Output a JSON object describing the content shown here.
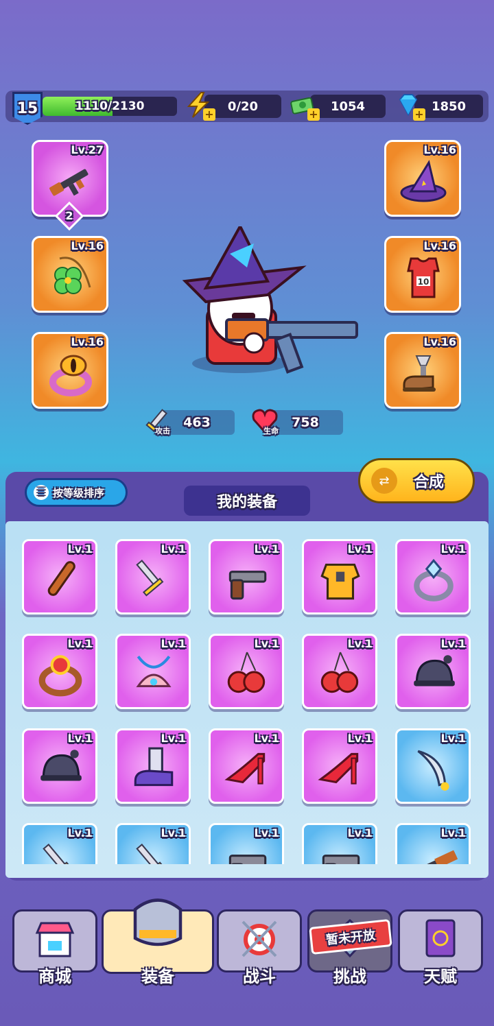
{
  "player": {
    "level": "15",
    "xp_text": "1110/2130",
    "xp_fraction": 0.52
  },
  "resources": [
    {
      "name": "energy",
      "icon": "lightning-icon",
      "value": "0/20"
    },
    {
      "name": "cash",
      "icon": "cash-icon",
      "value": "1054"
    },
    {
      "name": "gems",
      "icon": "diamond-icon",
      "value": "1850"
    }
  ],
  "equipped": [
    {
      "slot": "weapon",
      "icon": "rifle-icon",
      "level": "Lv.27",
      "rank": "2",
      "rarity": "pink"
    },
    {
      "slot": "hat",
      "icon": "wizard-hat-icon",
      "level": "Lv.16",
      "rarity": "orange"
    },
    {
      "slot": "necklace",
      "icon": "clover-necklace-icon",
      "level": "Lv.16",
      "rarity": "orange"
    },
    {
      "slot": "armor",
      "icon": "jersey-icon",
      "level": "Lv.16",
      "rarity": "orange"
    },
    {
      "slot": "ring",
      "icon": "eye-ring-icon",
      "level": "Lv.16",
      "rarity": "orange"
    },
    {
      "slot": "boots",
      "icon": "boots-icon",
      "level": "Lv.16",
      "rarity": "orange"
    }
  ],
  "stats": {
    "attack": {
      "label": "攻击",
      "value": "463"
    },
    "hp": {
      "label": "生命",
      "value": "758"
    }
  },
  "panel": {
    "sort_label": "按等级排序",
    "title": "我的装备",
    "combine_label": "合成"
  },
  "inventory": [
    {
      "icon": "bat-icon",
      "level": "Lv.1",
      "rarity": "pink"
    },
    {
      "icon": "dagger-icon",
      "level": "Lv.1",
      "rarity": "pink"
    },
    {
      "icon": "revolver-icon",
      "level": "Lv.1",
      "rarity": "pink"
    },
    {
      "icon": "chest-armor-icon",
      "level": "Lv.1",
      "rarity": "pink"
    },
    {
      "icon": "gem-ring-icon",
      "level": "Lv.1",
      "rarity": "pink"
    },
    {
      "icon": "ruby-ring-icon",
      "level": "Lv.1",
      "rarity": "pink"
    },
    {
      "icon": "shell-necklace-icon",
      "level": "Lv.1",
      "rarity": "pink"
    },
    {
      "icon": "boxing-gloves-icon",
      "level": "Lv.1",
      "rarity": "pink"
    },
    {
      "icon": "boxing-gloves-icon",
      "level": "Lv.1",
      "rarity": "pink"
    },
    {
      "icon": "helmet-icon",
      "level": "Lv.1",
      "rarity": "pink"
    },
    {
      "icon": "helmet-icon",
      "level": "Lv.1",
      "rarity": "pink"
    },
    {
      "icon": "sneaker-icon",
      "level": "Lv.1",
      "rarity": "pink"
    },
    {
      "icon": "high-heel-icon",
      "level": "Lv.1",
      "rarity": "pink"
    },
    {
      "icon": "high-heel-icon",
      "level": "Lv.1",
      "rarity": "pink"
    },
    {
      "icon": "curved-dagger-icon",
      "level": "Lv.1",
      "rarity": "blue"
    },
    {
      "icon": "dagger-icon",
      "level": "Lv.1",
      "rarity": "blue"
    },
    {
      "icon": "dagger-icon",
      "level": "Lv.1",
      "rarity": "blue"
    },
    {
      "icon": "revolver-icon",
      "level": "Lv.1",
      "rarity": "blue"
    },
    {
      "icon": "revolver-icon",
      "level": "Lv.1",
      "rarity": "blue"
    },
    {
      "icon": "rifle-icon",
      "level": "Lv.1",
      "rarity": "blue"
    }
  ],
  "nav": [
    {
      "icon": "shop-icon",
      "label": "商城",
      "state": "normal"
    },
    {
      "icon": "armor-icon",
      "label": "装备",
      "state": "active"
    },
    {
      "icon": "battle-target-icon",
      "label": "战斗",
      "state": "normal"
    },
    {
      "icon": "challenge-icon",
      "label": "挑战",
      "state": "locked",
      "stamp": "暂未开放"
    },
    {
      "icon": "talent-book-icon",
      "label": "天赋",
      "state": "normal"
    }
  ],
  "colors": {
    "pink": "#e060ec",
    "orange": "#f08a28",
    "blue": "#5cb8f0",
    "accent": "#ffd02a"
  }
}
